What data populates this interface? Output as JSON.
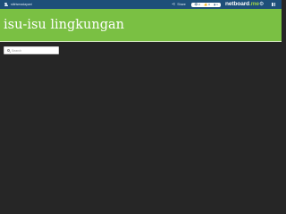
{
  "topbar": {
    "username": "sitirismadayani",
    "user_icon": "user-icon",
    "share_label": "Share",
    "share_icon": "share-icon",
    "stats": [
      {
        "icon": "eye-icon",
        "glyph": "👁",
        "value": "2"
      },
      {
        "icon": "thumb-icon",
        "glyph": "👍",
        "value": "0"
      },
      {
        "icon": "bookmark-icon",
        "glyph": "▮",
        "value": "1"
      }
    ],
    "logo_text": "netboard",
    "logo_suffix": ".me",
    "settings_icon": "gear-icon",
    "menu_icon": "grid-icon",
    "bar_color": "#1e4f79"
  },
  "header": {
    "title": "isu-isu lingkungan",
    "background_color": "#7ac043"
  },
  "search": {
    "placeholder": "Search",
    "value": ""
  },
  "board": {
    "background_color": "#262626"
  }
}
